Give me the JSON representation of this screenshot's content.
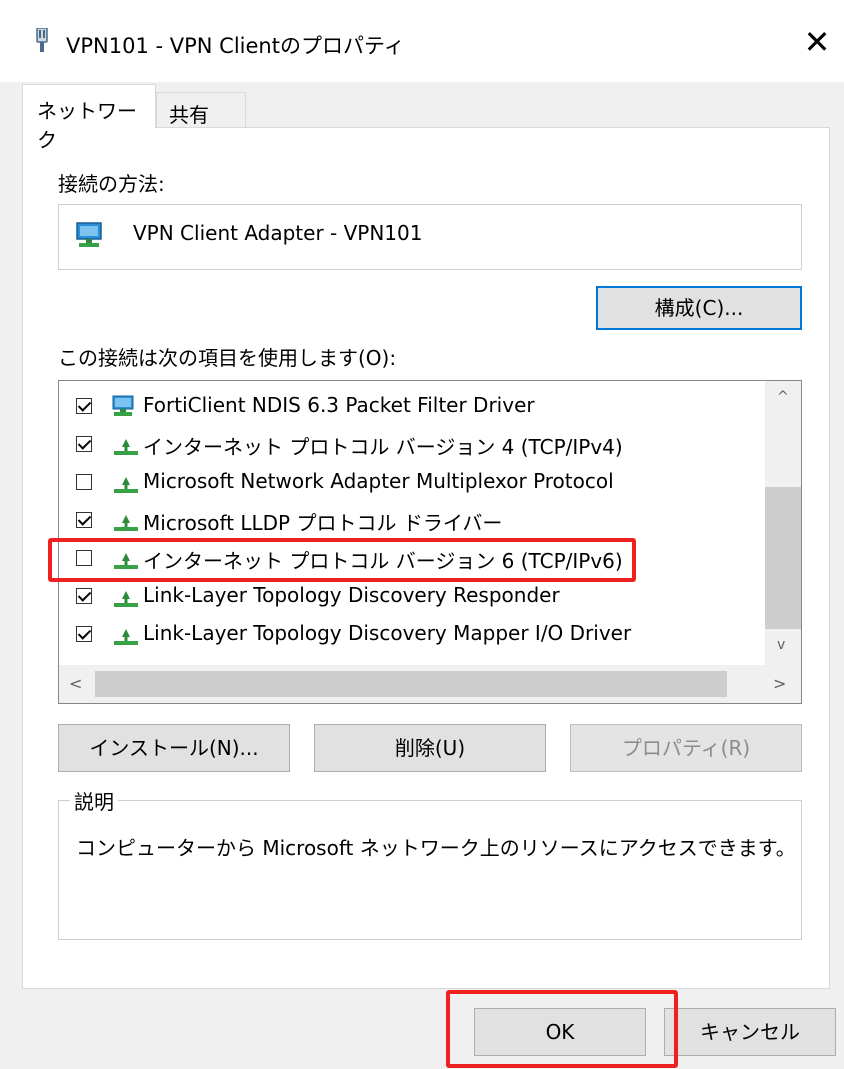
{
  "window": {
    "title": "VPN101 - VPN Clientのプロパティ",
    "close_glyph": "✕"
  },
  "tabs": [
    {
      "label": "ネットワーク",
      "active": true
    },
    {
      "label": "共有",
      "active": false
    }
  ],
  "connection": {
    "label": "接続の方法:",
    "adapter_name": "VPN Client Adapter - VPN101",
    "configure_button": "構成(C)..."
  },
  "items_section": {
    "label": "この接続は次の項目を使用します(O):",
    "items": [
      {
        "label": "FortiClient NDIS 6.3 Packet Filter Driver",
        "checked": true,
        "icon": "network-adapter-icon"
      },
      {
        "label": "インターネット プロトコル バージョン 4 (TCP/IPv4)",
        "checked": true,
        "icon": "protocol-icon"
      },
      {
        "label": "Microsoft Network Adapter Multiplexor Protocol",
        "checked": false,
        "icon": "protocol-icon"
      },
      {
        "label": "Microsoft LLDP プロトコル ドライバー",
        "checked": true,
        "icon": "protocol-icon"
      },
      {
        "label": "インターネット プロトコル バージョン 6 (TCP/IPv6)",
        "checked": false,
        "icon": "protocol-icon"
      },
      {
        "label": "Link-Layer Topology Discovery Responder",
        "checked": true,
        "icon": "protocol-icon"
      },
      {
        "label": "Link-Layer Topology Discovery Mapper I/O Driver",
        "checked": true,
        "icon": "protocol-icon"
      }
    ],
    "scroll_up_glyph": "^",
    "scroll_down_glyph": "v",
    "scroll_left_glyph": "<",
    "scroll_right_glyph": ">"
  },
  "buttons": {
    "install": "インストール(N)...",
    "uninstall": "削除(U)",
    "properties": "プロパティ(R)"
  },
  "description": {
    "legend": "説明",
    "text": "コンピューターから Microsoft ネットワーク上のリソースにアクセスできます。"
  },
  "footer": {
    "ok": "OK",
    "cancel": "キャンセル"
  },
  "colors": {
    "highlight": "#ef2020",
    "focus_border": "#0078d7"
  }
}
